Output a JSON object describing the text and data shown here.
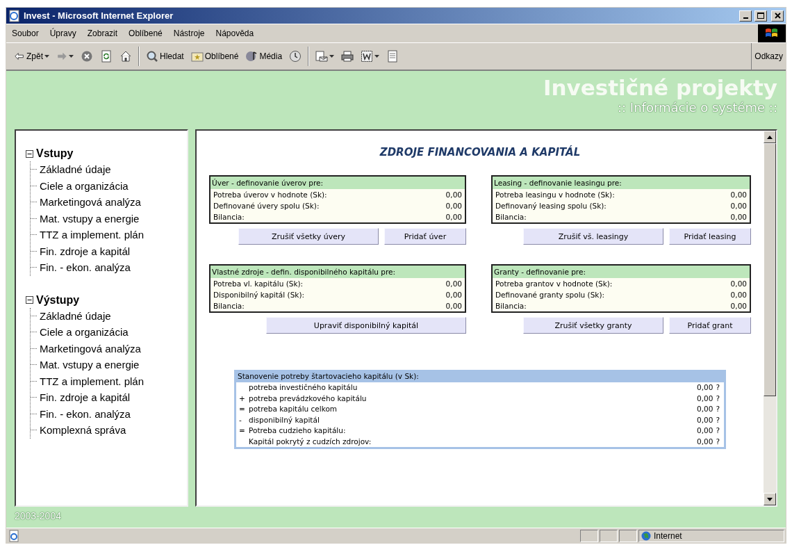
{
  "window": {
    "title": "Invest - Microsoft Internet Explorer"
  },
  "menu": [
    "Soubor",
    "Úpravy",
    "Zobrazit",
    "Oblíbené",
    "Nástroje",
    "Nápověda"
  ],
  "toolbar": {
    "items": [
      {
        "kind": "back",
        "label": "Zpět",
        "dropdown": true
      },
      {
        "kind": "forward",
        "dropdown": true
      },
      {
        "kind": "stop",
        "dropdown": false
      },
      {
        "kind": "refresh",
        "dropdown": false
      },
      {
        "kind": "home",
        "dropdown": false
      },
      {
        "kind": "separator"
      },
      {
        "kind": "search",
        "label": "Hledat",
        "dropdown": false
      },
      {
        "kind": "favorites",
        "label": "Oblíbené",
        "dropdown": false
      },
      {
        "kind": "media",
        "label": "Média",
        "dropdown": false
      },
      {
        "kind": "history",
        "dropdown": false
      },
      {
        "kind": "separator"
      },
      {
        "kind": "mail",
        "dropdown": true
      },
      {
        "kind": "print",
        "dropdown": false
      },
      {
        "kind": "edit",
        "dropdown": true
      },
      {
        "kind": "discuss",
        "dropdown": false
      }
    ],
    "links": "Odkazy"
  },
  "header": {
    "title": "Investičné projekty",
    "subtitle": ":: Informácie o systéme ::"
  },
  "sidebar": {
    "groups": [
      {
        "label": "Vstupy",
        "expanded": true,
        "children": [
          {
            "label": "Základné údaje"
          },
          {
            "label": "Ciele a organizácia"
          },
          {
            "label": "Marketingová analýza"
          },
          {
            "label": "Mat. vstupy a energie"
          },
          {
            "label": "TTZ a implement. plán"
          },
          {
            "label": "Fin. zdroje a kapitál"
          },
          {
            "label": "Fin. - ekon. analýza"
          }
        ]
      },
      {
        "label": "Výstupy",
        "expanded": true,
        "children": [
          {
            "label": "Základné údaje"
          },
          {
            "label": "Ciele a organizácia"
          },
          {
            "label": "Marketingová analýza"
          },
          {
            "label": "Mat. vstupy a energie"
          },
          {
            "label": "TTZ a implement. plán"
          },
          {
            "label": "Fin. zdroje a kapitál"
          },
          {
            "label": "Fin. - ekon. analýza"
          },
          {
            "label": "Komplexná správa"
          }
        ]
      }
    ]
  },
  "main": {
    "heading": "ZDROJE FINANCOVANIA A KAPITÁL",
    "panels": [
      {
        "title": "Úver - definovanie úverov pre:",
        "rows": [
          {
            "label": "Potreba úverov v hodnote (Sk):",
            "value": "0,00"
          },
          {
            "label": "Definované úvery spolu (Sk):",
            "value": "0,00"
          },
          {
            "label": "Bilancia:",
            "value": "0,00"
          }
        ],
        "buttons": [
          "Zrušiť všetky úvery",
          "Pridať úver"
        ]
      },
      {
        "title": "Leasing - definovanie leasingu pre:",
        "rows": [
          {
            "label": "Potreba leasingu v hodnote (Sk):",
            "value": "0,00"
          },
          {
            "label": "Definovaný leasing spolu (Sk):",
            "value": "0,00"
          },
          {
            "label": "Bilancia:",
            "value": "0,00"
          }
        ],
        "buttons": [
          "Zrušiť vš. leasingy",
          "Pridať leasing"
        ]
      },
      {
        "title": "Vlastné zdroje - defin. disponibilného kapitálu pre:",
        "rows": [
          {
            "label": "Potreba vl. kapitálu  (Sk):",
            "value": "0,00"
          },
          {
            "label": "Disponibilný kapitál (Sk):",
            "value": "0,00"
          },
          {
            "label": "Bilancia:",
            "value": "0,00"
          }
        ],
        "buttons": [
          "Upraviť disponibilný kapitál"
        ]
      },
      {
        "title": "Granty - definovanie pre:",
        "rows": [
          {
            "label": "Potreba grantov v hodnote (Sk):",
            "value": "0,00"
          },
          {
            "label": "Definované granty spolu (Sk):",
            "value": "0,00"
          },
          {
            "label": "Bilancia:",
            "value": "0,00"
          }
        ],
        "buttons": [
          "Zrušiť všetky granty",
          "Pridať grant"
        ]
      }
    ],
    "summary": {
      "title": "Stanovenie potreby štartovacieho kapitálu (v Sk):",
      "rows": [
        {
          "label": "potreba investičného kapitálu",
          "value": "0,00",
          "hint": "?"
        },
        {
          "sign": "+",
          "label": "potreba prevádzkového kapitálu",
          "value": "0,00",
          "hint": "?"
        },
        {
          "sign": "=",
          "label": "potreba kapitálu celkom",
          "value": "0,00",
          "hint": "?"
        },
        {
          "sign": "-",
          "label": "disponibilný kapitál",
          "value": "0,00",
          "hint": "?"
        },
        {
          "sign": "=",
          "label": "Potreba cudzieho kapitálu:",
          "value": "0,00",
          "hint": "?"
        },
        {
          "label": "Kapitál pokrytý z cudzích zdrojov:",
          "value": "0,00",
          "hint": "?"
        }
      ]
    }
  },
  "footer": "2003-2004",
  "status_bar": {
    "zone": "Internet"
  }
}
